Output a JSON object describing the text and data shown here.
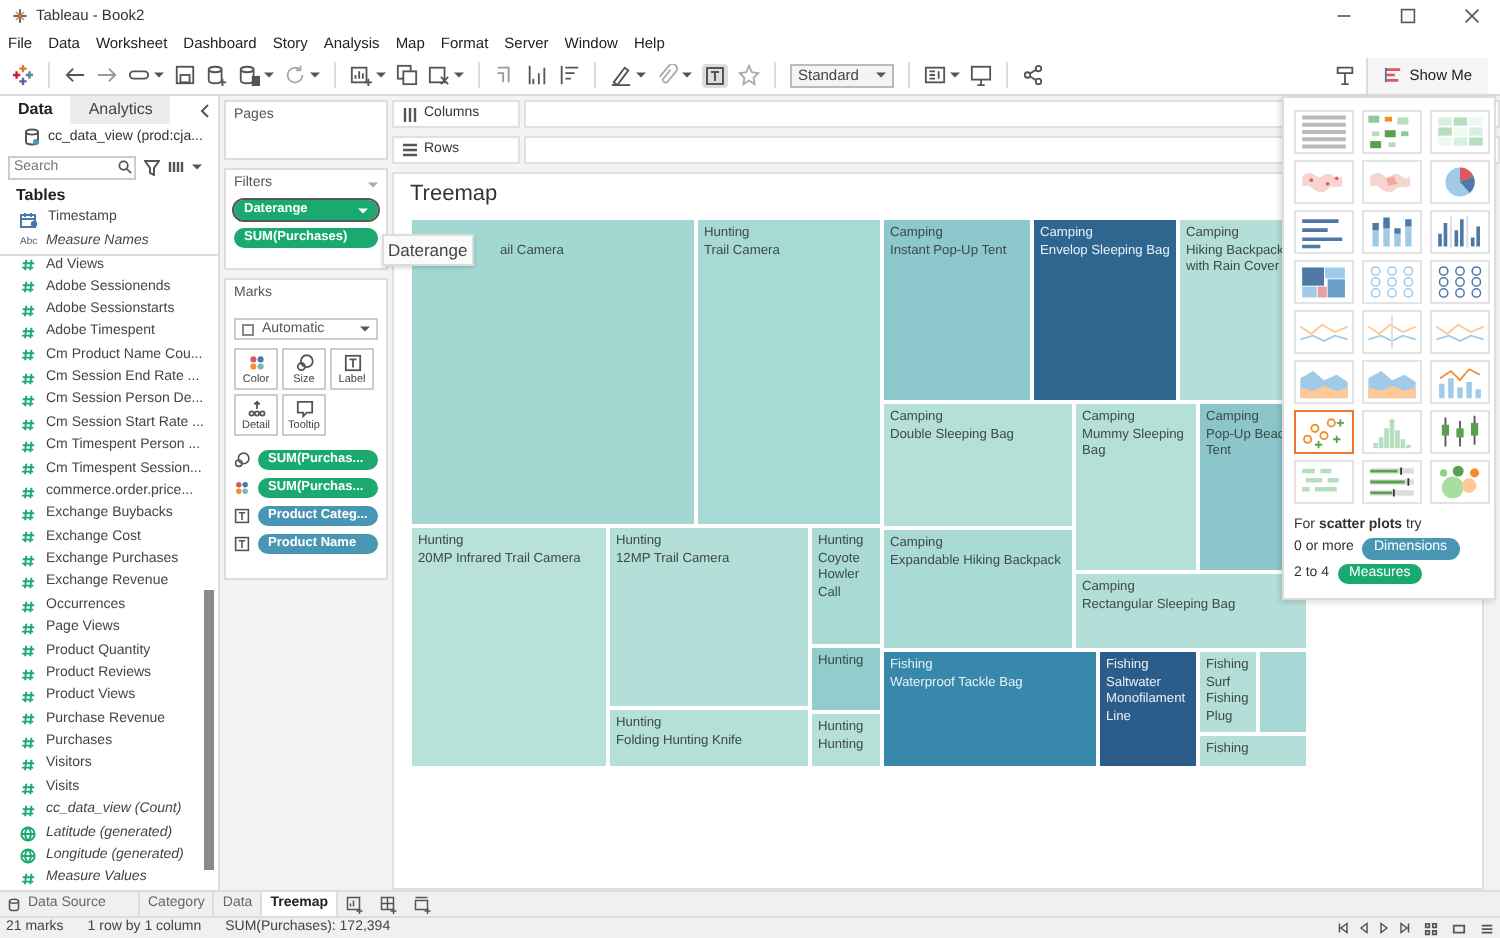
{
  "window": {
    "title": "Tableau - Book2"
  },
  "menu": [
    "File",
    "Data",
    "Worksheet",
    "Dashboard",
    "Story",
    "Analysis",
    "Map",
    "Format",
    "Server",
    "Window",
    "Help"
  ],
  "toolbar": {
    "labels_on": true,
    "fit": "Standard",
    "show_me": "Show Me"
  },
  "data_pane": {
    "tabs": [
      {
        "label": "Data",
        "selected": true
      },
      {
        "label": "Analytics",
        "selected": false
      }
    ],
    "source": "cc_data_view (prod:cja...",
    "search": {
      "placeholder": "Search"
    },
    "heading": "Tables",
    "fields": [
      {
        "name": "Timestamp",
        "kind": "date",
        "italic": false
      },
      {
        "name": "Measure Names",
        "kind": "text",
        "icon_text": "Abc",
        "italic": true
      },
      {
        "name": "Ad Views",
        "kind": "measure",
        "italic": false
      },
      {
        "name": "Adobe Sessionends",
        "kind": "measure",
        "italic": false
      },
      {
        "name": "Adobe Sessionstarts",
        "kind": "measure",
        "italic": false
      },
      {
        "name": "Adobe Timespent",
        "kind": "measure",
        "italic": false
      },
      {
        "name": "Cm Product Name Cou...",
        "kind": "measure",
        "italic": false
      },
      {
        "name": "Cm Session End Rate ...",
        "kind": "measure",
        "italic": false
      },
      {
        "name": "Cm Session Person De...",
        "kind": "measure",
        "italic": false
      },
      {
        "name": "Cm Session Start Rate ...",
        "kind": "measure",
        "italic": false
      },
      {
        "name": "Cm Timespent Person ...",
        "kind": "measure",
        "italic": false
      },
      {
        "name": "Cm Timespent Session...",
        "kind": "measure",
        "italic": false
      },
      {
        "name": "commerce.order.price...",
        "kind": "measure",
        "italic": false
      },
      {
        "name": "Exchange Buybacks",
        "kind": "measure",
        "italic": false
      },
      {
        "name": "Exchange Cost",
        "kind": "measure",
        "italic": false
      },
      {
        "name": "Exchange Purchases",
        "kind": "measure",
        "italic": false
      },
      {
        "name": "Exchange Revenue",
        "kind": "measure",
        "italic": false
      },
      {
        "name": "Occurrences",
        "kind": "measure",
        "italic": false
      },
      {
        "name": "Page Views",
        "kind": "measure",
        "italic": false
      },
      {
        "name": "Product Quantity",
        "kind": "measure",
        "italic": false
      },
      {
        "name": "Product Reviews",
        "kind": "measure",
        "italic": false
      },
      {
        "name": "Product Views",
        "kind": "measure",
        "italic": false
      },
      {
        "name": "Purchase Revenue",
        "kind": "measure",
        "italic": false
      },
      {
        "name": "Purchases",
        "kind": "measure",
        "italic": false
      },
      {
        "name": "Visitors",
        "kind": "measure",
        "italic": false
      },
      {
        "name": "Visits",
        "kind": "measure",
        "italic": false
      },
      {
        "name": "cc_data_view (Count)",
        "kind": "measure",
        "italic": true
      },
      {
        "name": "Latitude (generated)",
        "kind": "geo",
        "italic": true
      },
      {
        "name": "Longitude (generated)",
        "kind": "geo",
        "italic": true
      },
      {
        "name": "Measure Values",
        "kind": "measure",
        "italic": true
      }
    ]
  },
  "cards": {
    "pages": "Pages",
    "filters": {
      "title": "Filters",
      "pills": [
        {
          "label": "Daterange",
          "kind": "continuous",
          "selected": true
        },
        {
          "label": "SUM(Purchases)",
          "kind": "continuous",
          "selected": false
        }
      ]
    },
    "marks": {
      "title": "Marks",
      "type": "Automatic",
      "buttons": [
        {
          "kind": "color",
          "label": "Color"
        },
        {
          "kind": "size",
          "label": "Size"
        },
        {
          "kind": "label",
          "label": "Label"
        },
        {
          "kind": "detail",
          "label": "Detail"
        },
        {
          "kind": "tooltip",
          "label": "Tooltip"
        }
      ],
      "pills": [
        {
          "label": "SUM(Purchas...",
          "kind": "continuous"
        },
        {
          "label": "SUM(Purchas...",
          "kind": "continuous"
        },
        {
          "label": "Product Categ...",
          "kind": "discrete"
        },
        {
          "label": "Product Name",
          "kind": "discrete"
        }
      ]
    }
  },
  "shelves": [
    {
      "kind": "columns",
      "label": "Columns"
    },
    {
      "kind": "rows",
      "label": "Rows"
    }
  ],
  "view": {
    "title": "Treemap",
    "tooltip": "Daterange",
    "tiles": [
      {
        "lines": [
          "ail Camera"
        ],
        "covered": true,
        "color": "#a3d8d2"
      },
      {
        "lines": [
          "Hunting",
          "Trail Camera"
        ],
        "color": "#a8dad5"
      },
      {
        "lines": [
          "Hunting",
          "20MP Infrared Trail Camera"
        ],
        "color": "#b8e2d9"
      },
      {
        "lines": [
          "Hunting",
          "12MP Trail Camera"
        ],
        "color": "#b3dfd8"
      },
      {
        "lines": [
          "Hunting",
          "Folding Hunting Knife"
        ],
        "color": "#b5e0d8"
      },
      {
        "lines": [
          "Hunting",
          "Coyote",
          "Howler",
          "Call"
        ],
        "color": "#a9dad5"
      },
      {
        "lines": [
          "Hunting"
        ],
        "color": "#92cccd"
      },
      {
        "lines": [
          "Hunting",
          "Hunting"
        ],
        "color": "#b5e0d8"
      },
      {
        "lines": [
          "Camping",
          "Instant Pop-Up Tent"
        ],
        "color": "#8cc8cc"
      },
      {
        "lines": [
          "Camping",
          "Envelop Sleeping Bag"
        ],
        "color": "#2e6690"
      },
      {
        "lines": [
          "Camping",
          "Hiking Backpack",
          "with Rain Cover"
        ],
        "color": "#b3dfd8"
      },
      {
        "lines": [
          "Camping",
          "Double Sleeping Bag"
        ],
        "color": "#b5e0d8"
      },
      {
        "lines": [
          "Camping",
          "Expandable Hiking Backpack"
        ],
        "color": "#a9dad5"
      },
      {
        "lines": [
          "Camping",
          "Mummy Sleeping",
          "Bag"
        ],
        "color": "#b5e0d8"
      },
      {
        "lines": [
          "Camping",
          "Pop-Up Beac",
          "Tent"
        ],
        "color": "#8cc6cb"
      },
      {
        "lines": [
          "Camping",
          "Rectangular Sleeping Bag"
        ],
        "color": "#b3dfd8"
      },
      {
        "lines": [
          "Fishing",
          "Waterproof Tackle Bag"
        ],
        "color": "#3788aa"
      },
      {
        "lines": [
          "Fishing",
          "Saltwater",
          "Monofilament",
          "Line"
        ],
        "color": "#2c5d8a"
      },
      {
        "lines": [
          "Fishing",
          "Surf",
          "Fishing",
          "Plug"
        ],
        "color": "#b3dfd8"
      },
      {
        "color": "#a8d8d6"
      },
      {
        "lines": [
          "Fishing"
        ],
        "color": "#b3dfd8"
      }
    ]
  },
  "show_me": {
    "charts": [
      {
        "kind": "text-table",
        "selected": false
      },
      {
        "kind": "heat-map",
        "selected": false
      },
      {
        "kind": "highlight-table",
        "selected": false
      },
      {
        "kind": "symbol-map",
        "selected": false
      },
      {
        "kind": "filled-map",
        "selected": false
      },
      {
        "kind": "pie",
        "selected": false
      },
      {
        "kind": "horizontal-bars",
        "selected": false
      },
      {
        "kind": "stacked-bars",
        "selected": false
      },
      {
        "kind": "side-by-side-bars",
        "selected": false
      },
      {
        "kind": "treemap",
        "selected": false
      },
      {
        "kind": "circle-view",
        "selected": false
      },
      {
        "kind": "side-by-side-circles",
        "selected": false
      },
      {
        "kind": "lines",
        "selected": false
      },
      {
        "kind": "lines-discrete",
        "selected": false
      },
      {
        "kind": "dual-lines",
        "selected": false
      },
      {
        "kind": "area",
        "selected": false
      },
      {
        "kind": "area-discrete",
        "selected": false
      },
      {
        "kind": "dual-combination",
        "selected": false
      },
      {
        "kind": "scatter",
        "selected": true
      },
      {
        "kind": "histogram",
        "selected": false
      },
      {
        "kind": "box-plot",
        "selected": false
      },
      {
        "kind": "gantt",
        "selected": false
      },
      {
        "kind": "bullet",
        "selected": false
      },
      {
        "kind": "packed-bubbles",
        "selected": false
      }
    ],
    "hint": "For **scatter plots** try",
    "requirements": [
      {
        "text": "0 or more",
        "pill": "Dimensions",
        "kind": "discrete"
      },
      {
        "text": "2 to 4",
        "pill": "Measures",
        "kind": "continuous"
      }
    ]
  },
  "sheet_tabs": [
    {
      "label": "Data Source",
      "kind": "source",
      "selected": false
    },
    {
      "label": "Category",
      "kind": "sheet",
      "selected": false
    },
    {
      "label": "Data",
      "kind": "sheet",
      "selected": false
    },
    {
      "label": "Treemap",
      "kind": "sheet",
      "selected": true
    }
  ],
  "status_bar": [
    "21 marks",
    "1 row by 1 column",
    "SUM(Purchases): 172,394"
  ]
}
